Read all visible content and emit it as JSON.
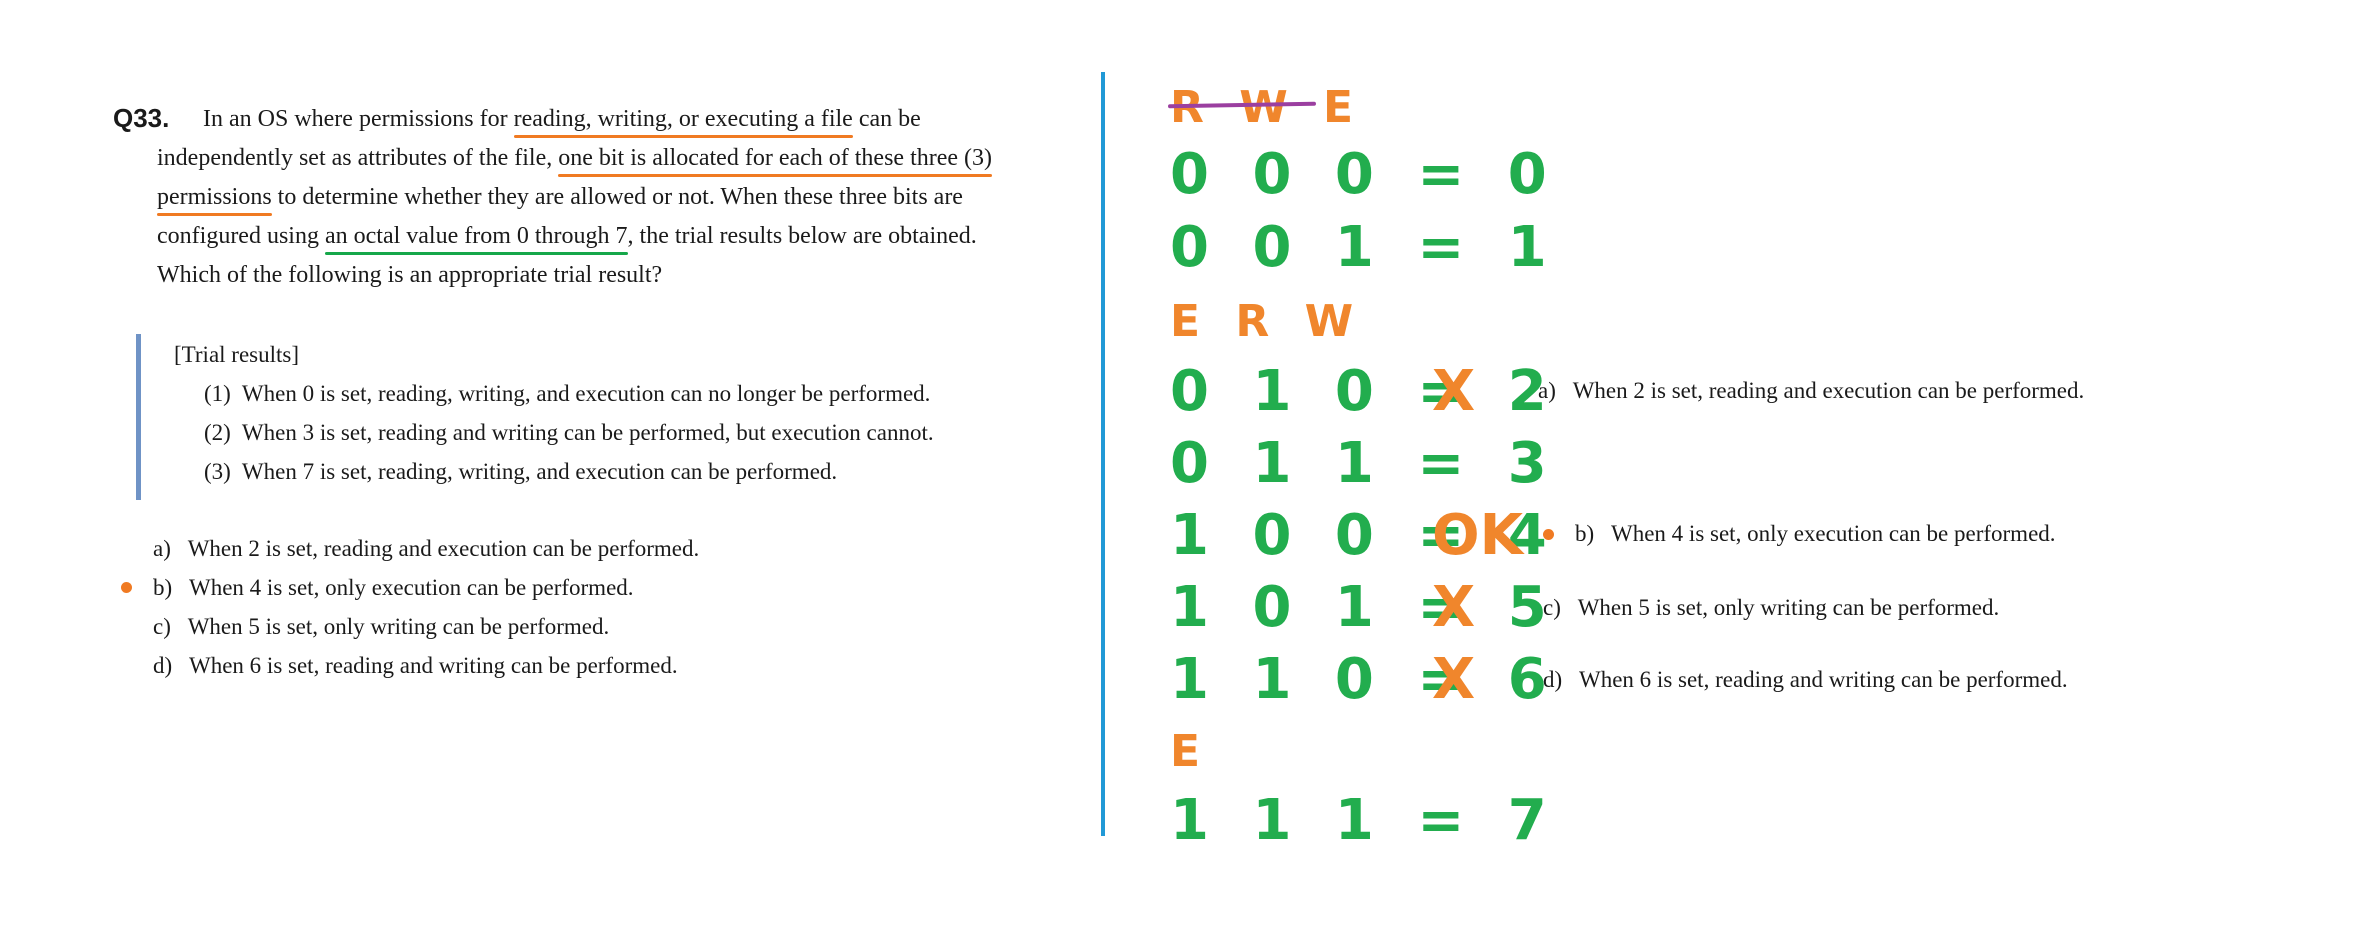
{
  "question": {
    "number": "Q33.",
    "lines": [
      [
        "In an OS where permissions for ",
        "reading, writing, or executing a file",
        " can be"
      ],
      [
        "independently set as attributes of the file, ",
        "one bit is allocated for each of these three (3)"
      ],
      [
        "permissions",
        " to determine whether they are allowed or not. When these three bits are"
      ],
      [
        "configured using ",
        "an octal value from 0 through 7",
        ", the trial results below are obtained."
      ],
      [
        "Which of the following is an appropriate trial result?"
      ]
    ]
  },
  "trial_results": {
    "heading": "[Trial results]",
    "items": [
      {
        "num": "(1)",
        "text": "When 0 is set, reading, writing, and execution can no longer be performed."
      },
      {
        "num": "(2)",
        "text": "When 3 is set, reading and writing can be performed, but execution cannot."
      },
      {
        "num": "(3)",
        "text": "When 7 is set, reading, writing, and execution can be performed."
      }
    ]
  },
  "options": [
    {
      "letter": "a)",
      "text": "When 2 is set, reading and execution can be performed."
    },
    {
      "letter": "b)",
      "text": "When 4 is set, only execution can be performed."
    },
    {
      "letter": "c)",
      "text": "When 5 is set, only writing can be performed."
    },
    {
      "letter": "d)",
      "text": "When 6 is set, reading and writing can be performed."
    }
  ],
  "notes": {
    "header_struck": "R W E",
    "header_erw": "E R W",
    "header_e": "E",
    "rows": [
      "0 0 0 = 0",
      "0 0 1 = 1",
      "0 1 0 = 2",
      "0 1 1 = 3",
      "1 0 0 = 4",
      "1 0 1 = 5",
      "1 1 0 = 6",
      "1 1 1 = 7"
    ],
    "marks": {
      "row2": "X",
      "row4": "OK",
      "row5": "X",
      "row6": "X"
    },
    "right_options": [
      {
        "letter": "a)",
        "text": "When 2 is set, reading and execution can be performed."
      },
      {
        "letter": "b)",
        "text": "When 4 is set, only execution can be performed."
      },
      {
        "letter": "c)",
        "text": "When 5 is set, only writing can be performed."
      },
      {
        "letter": "d)",
        "text": "When 6 is set, reading and writing can be performed."
      }
    ]
  },
  "colors": {
    "orange": "#f07a22",
    "green": "#22ad4e",
    "blue_divider": "#2199d6",
    "purple_strike": "#9b3fa0",
    "quote_bar": "#6f93c6"
  }
}
